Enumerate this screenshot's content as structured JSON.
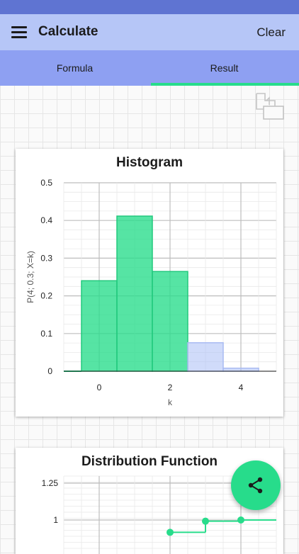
{
  "appbar": {
    "title": "Calculate",
    "clear_label": "Clear",
    "menu_icon": "hamburger-menu-icon"
  },
  "tabs": [
    {
      "label": "Formula",
      "selected": false
    },
    {
      "label": "Result",
      "selected": true
    }
  ],
  "colors": {
    "statusbar": "#5f74d2",
    "appbar": "#b6c6f7",
    "tabbar": "#8ea0f2",
    "accent": "#27dc8b",
    "secondary_bar": "#cdd7fb"
  },
  "toggle_icon": "view-toggle-icon",
  "fab": {
    "icon": "share-icon"
  },
  "chart_data": [
    {
      "type": "bar",
      "title": "Histogram",
      "xlabel": "k",
      "ylabel": "P(4; 0.3; X=k)",
      "categories": [
        0,
        1,
        2,
        3,
        4
      ],
      "series": [
        {
          "values": [
            0.2401,
            0.4116,
            0.2646,
            null,
            null
          ]
        },
        {
          "values": [
            null,
            null,
            null,
            0.0756,
            0.0081
          ]
        }
      ],
      "xticks": [
        "0",
        "2",
        "4"
      ],
      "yticks": [
        "0",
        "0.1",
        "0.2",
        "0.3",
        "0.4",
        "0.5"
      ],
      "ylim": [
        0,
        0.5
      ],
      "xlim": [
        -1,
        5
      ],
      "grid": true
    },
    {
      "type": "line",
      "title": "Distribution Function",
      "yticks": [
        "1",
        "1.25"
      ],
      "x": [
        2,
        3,
        4
      ],
      "values": [
        0.9163,
        0.9919,
        1
      ],
      "grid": true
    }
  ]
}
